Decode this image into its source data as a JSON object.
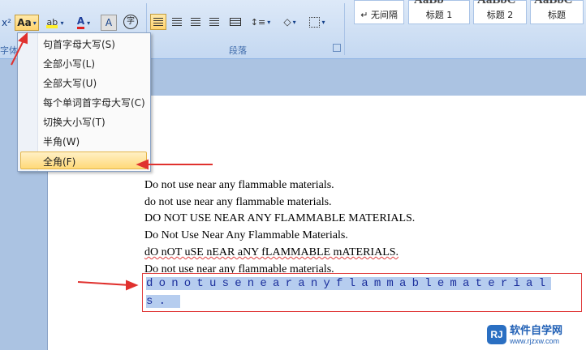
{
  "ribbon": {
    "font_group_label": "字体",
    "paragraph_group_label": "段落",
    "superscript": "x²",
    "change_case": "Aa",
    "font_color": "A",
    "char_shading": "A",
    "enclose_char": "字"
  },
  "styles": [
    {
      "preview": "AaBb",
      "label": "↵ 无间隔"
    },
    {
      "preview": "AaBb",
      "label": "标题 1"
    },
    {
      "preview": "AaBbC",
      "label": "标题 2"
    },
    {
      "preview": "AaBbC",
      "label": "标题"
    }
  ],
  "menu": {
    "items": [
      {
        "label": "句首字母大写(S)"
      },
      {
        "label": "全部小写(L)"
      },
      {
        "label": "全部大写(U)"
      },
      {
        "label": "每个单词首字母大写(C)"
      },
      {
        "label": "切换大小写(T)"
      },
      {
        "label": "半角(W)"
      },
      {
        "label": "全角(F)"
      }
    ]
  },
  "document": {
    "lines": [
      "Do not use near any flammable materials.",
      "do not use near any flammable materials.",
      "DO NOT USE NEAR ANY FLAMMABLE MATERIALS.",
      "Do Not Use Near Any Flammable Materials.",
      "dO nOT uSE nEAR aNY fLAMMABLE mATERIALS.",
      "Do not use near any flammable materials."
    ],
    "fullwidth_line1": "donotusenearanyflammablematerial",
    "fullwidth_line2": "s."
  },
  "watermark": {
    "brand": "软件自学网",
    "url": "www.rjzxw.com"
  },
  "colors": {
    "accent_red": "#e0312e",
    "selection": "#b6cdef",
    "ribbon": "#c4d8f1"
  }
}
